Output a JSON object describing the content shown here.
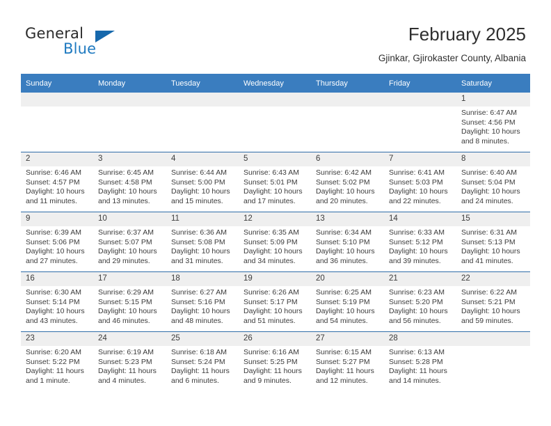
{
  "brand": {
    "word1": "General",
    "word2": "Blue",
    "triangle_color": "#1668ac",
    "blue_color": "#1f7ac0"
  },
  "header": {
    "title": "February 2025",
    "subtitle": "Gjinkar, Gjirokaster County, Albania"
  },
  "theme": {
    "header_bg": "#3a7dbf",
    "row_divider": "#2f6ca8",
    "daynum_bg": "#efefef",
    "text": "#3b3b3b"
  },
  "calendar": {
    "weekday_headers": [
      "Sunday",
      "Monday",
      "Tuesday",
      "Wednesday",
      "Thursday",
      "Friday",
      "Saturday"
    ],
    "weeks": [
      [
        {
          "day": "",
          "sunrise": "",
          "sunset": "",
          "daylight": "",
          "blank": true
        },
        {
          "day": "",
          "sunrise": "",
          "sunset": "",
          "daylight": "",
          "blank": true
        },
        {
          "day": "",
          "sunrise": "",
          "sunset": "",
          "daylight": "",
          "blank": true
        },
        {
          "day": "",
          "sunrise": "",
          "sunset": "",
          "daylight": "",
          "blank": true
        },
        {
          "day": "",
          "sunrise": "",
          "sunset": "",
          "daylight": "",
          "blank": true
        },
        {
          "day": "",
          "sunrise": "",
          "sunset": "",
          "daylight": "",
          "blank": true
        },
        {
          "day": "1",
          "sunrise": "Sunrise: 6:47 AM",
          "sunset": "Sunset: 4:56 PM",
          "daylight": "Daylight: 10 hours and 8 minutes.",
          "blank": false
        }
      ],
      [
        {
          "day": "2",
          "sunrise": "Sunrise: 6:46 AM",
          "sunset": "Sunset: 4:57 PM",
          "daylight": "Daylight: 10 hours and 11 minutes.",
          "blank": false
        },
        {
          "day": "3",
          "sunrise": "Sunrise: 6:45 AM",
          "sunset": "Sunset: 4:58 PM",
          "daylight": "Daylight: 10 hours and 13 minutes.",
          "blank": false
        },
        {
          "day": "4",
          "sunrise": "Sunrise: 6:44 AM",
          "sunset": "Sunset: 5:00 PM",
          "daylight": "Daylight: 10 hours and 15 minutes.",
          "blank": false
        },
        {
          "day": "5",
          "sunrise": "Sunrise: 6:43 AM",
          "sunset": "Sunset: 5:01 PM",
          "daylight": "Daylight: 10 hours and 17 minutes.",
          "blank": false
        },
        {
          "day": "6",
          "sunrise": "Sunrise: 6:42 AM",
          "sunset": "Sunset: 5:02 PM",
          "daylight": "Daylight: 10 hours and 20 minutes.",
          "blank": false
        },
        {
          "day": "7",
          "sunrise": "Sunrise: 6:41 AM",
          "sunset": "Sunset: 5:03 PM",
          "daylight": "Daylight: 10 hours and 22 minutes.",
          "blank": false
        },
        {
          "day": "8",
          "sunrise": "Sunrise: 6:40 AM",
          "sunset": "Sunset: 5:04 PM",
          "daylight": "Daylight: 10 hours and 24 minutes.",
          "blank": false
        }
      ],
      [
        {
          "day": "9",
          "sunrise": "Sunrise: 6:39 AM",
          "sunset": "Sunset: 5:06 PM",
          "daylight": "Daylight: 10 hours and 27 minutes.",
          "blank": false
        },
        {
          "day": "10",
          "sunrise": "Sunrise: 6:37 AM",
          "sunset": "Sunset: 5:07 PM",
          "daylight": "Daylight: 10 hours and 29 minutes.",
          "blank": false
        },
        {
          "day": "11",
          "sunrise": "Sunrise: 6:36 AM",
          "sunset": "Sunset: 5:08 PM",
          "daylight": "Daylight: 10 hours and 31 minutes.",
          "blank": false
        },
        {
          "day": "12",
          "sunrise": "Sunrise: 6:35 AM",
          "sunset": "Sunset: 5:09 PM",
          "daylight": "Daylight: 10 hours and 34 minutes.",
          "blank": false
        },
        {
          "day": "13",
          "sunrise": "Sunrise: 6:34 AM",
          "sunset": "Sunset: 5:10 PM",
          "daylight": "Daylight: 10 hours and 36 minutes.",
          "blank": false
        },
        {
          "day": "14",
          "sunrise": "Sunrise: 6:33 AM",
          "sunset": "Sunset: 5:12 PM",
          "daylight": "Daylight: 10 hours and 39 minutes.",
          "blank": false
        },
        {
          "day": "15",
          "sunrise": "Sunrise: 6:31 AM",
          "sunset": "Sunset: 5:13 PM",
          "daylight": "Daylight: 10 hours and 41 minutes.",
          "blank": false
        }
      ],
      [
        {
          "day": "16",
          "sunrise": "Sunrise: 6:30 AM",
          "sunset": "Sunset: 5:14 PM",
          "daylight": "Daylight: 10 hours and 43 minutes.",
          "blank": false
        },
        {
          "day": "17",
          "sunrise": "Sunrise: 6:29 AM",
          "sunset": "Sunset: 5:15 PM",
          "daylight": "Daylight: 10 hours and 46 minutes.",
          "blank": false
        },
        {
          "day": "18",
          "sunrise": "Sunrise: 6:27 AM",
          "sunset": "Sunset: 5:16 PM",
          "daylight": "Daylight: 10 hours and 48 minutes.",
          "blank": false
        },
        {
          "day": "19",
          "sunrise": "Sunrise: 6:26 AM",
          "sunset": "Sunset: 5:17 PM",
          "daylight": "Daylight: 10 hours and 51 minutes.",
          "blank": false
        },
        {
          "day": "20",
          "sunrise": "Sunrise: 6:25 AM",
          "sunset": "Sunset: 5:19 PM",
          "daylight": "Daylight: 10 hours and 54 minutes.",
          "blank": false
        },
        {
          "day": "21",
          "sunrise": "Sunrise: 6:23 AM",
          "sunset": "Sunset: 5:20 PM",
          "daylight": "Daylight: 10 hours and 56 minutes.",
          "blank": false
        },
        {
          "day": "22",
          "sunrise": "Sunrise: 6:22 AM",
          "sunset": "Sunset: 5:21 PM",
          "daylight": "Daylight: 10 hours and 59 minutes.",
          "blank": false
        }
      ],
      [
        {
          "day": "23",
          "sunrise": "Sunrise: 6:20 AM",
          "sunset": "Sunset: 5:22 PM",
          "daylight": "Daylight: 11 hours and 1 minute.",
          "blank": false
        },
        {
          "day": "24",
          "sunrise": "Sunrise: 6:19 AM",
          "sunset": "Sunset: 5:23 PM",
          "daylight": "Daylight: 11 hours and 4 minutes.",
          "blank": false
        },
        {
          "day": "25",
          "sunrise": "Sunrise: 6:18 AM",
          "sunset": "Sunset: 5:24 PM",
          "daylight": "Daylight: 11 hours and 6 minutes.",
          "blank": false
        },
        {
          "day": "26",
          "sunrise": "Sunrise: 6:16 AM",
          "sunset": "Sunset: 5:25 PM",
          "daylight": "Daylight: 11 hours and 9 minutes.",
          "blank": false
        },
        {
          "day": "27",
          "sunrise": "Sunrise: 6:15 AM",
          "sunset": "Sunset: 5:27 PM",
          "daylight": "Daylight: 11 hours and 12 minutes.",
          "blank": false
        },
        {
          "day": "28",
          "sunrise": "Sunrise: 6:13 AM",
          "sunset": "Sunset: 5:28 PM",
          "daylight": "Daylight: 11 hours and 14 minutes.",
          "blank": false
        },
        {
          "day": "",
          "sunrise": "",
          "sunset": "",
          "daylight": "",
          "blank": true
        }
      ]
    ]
  }
}
